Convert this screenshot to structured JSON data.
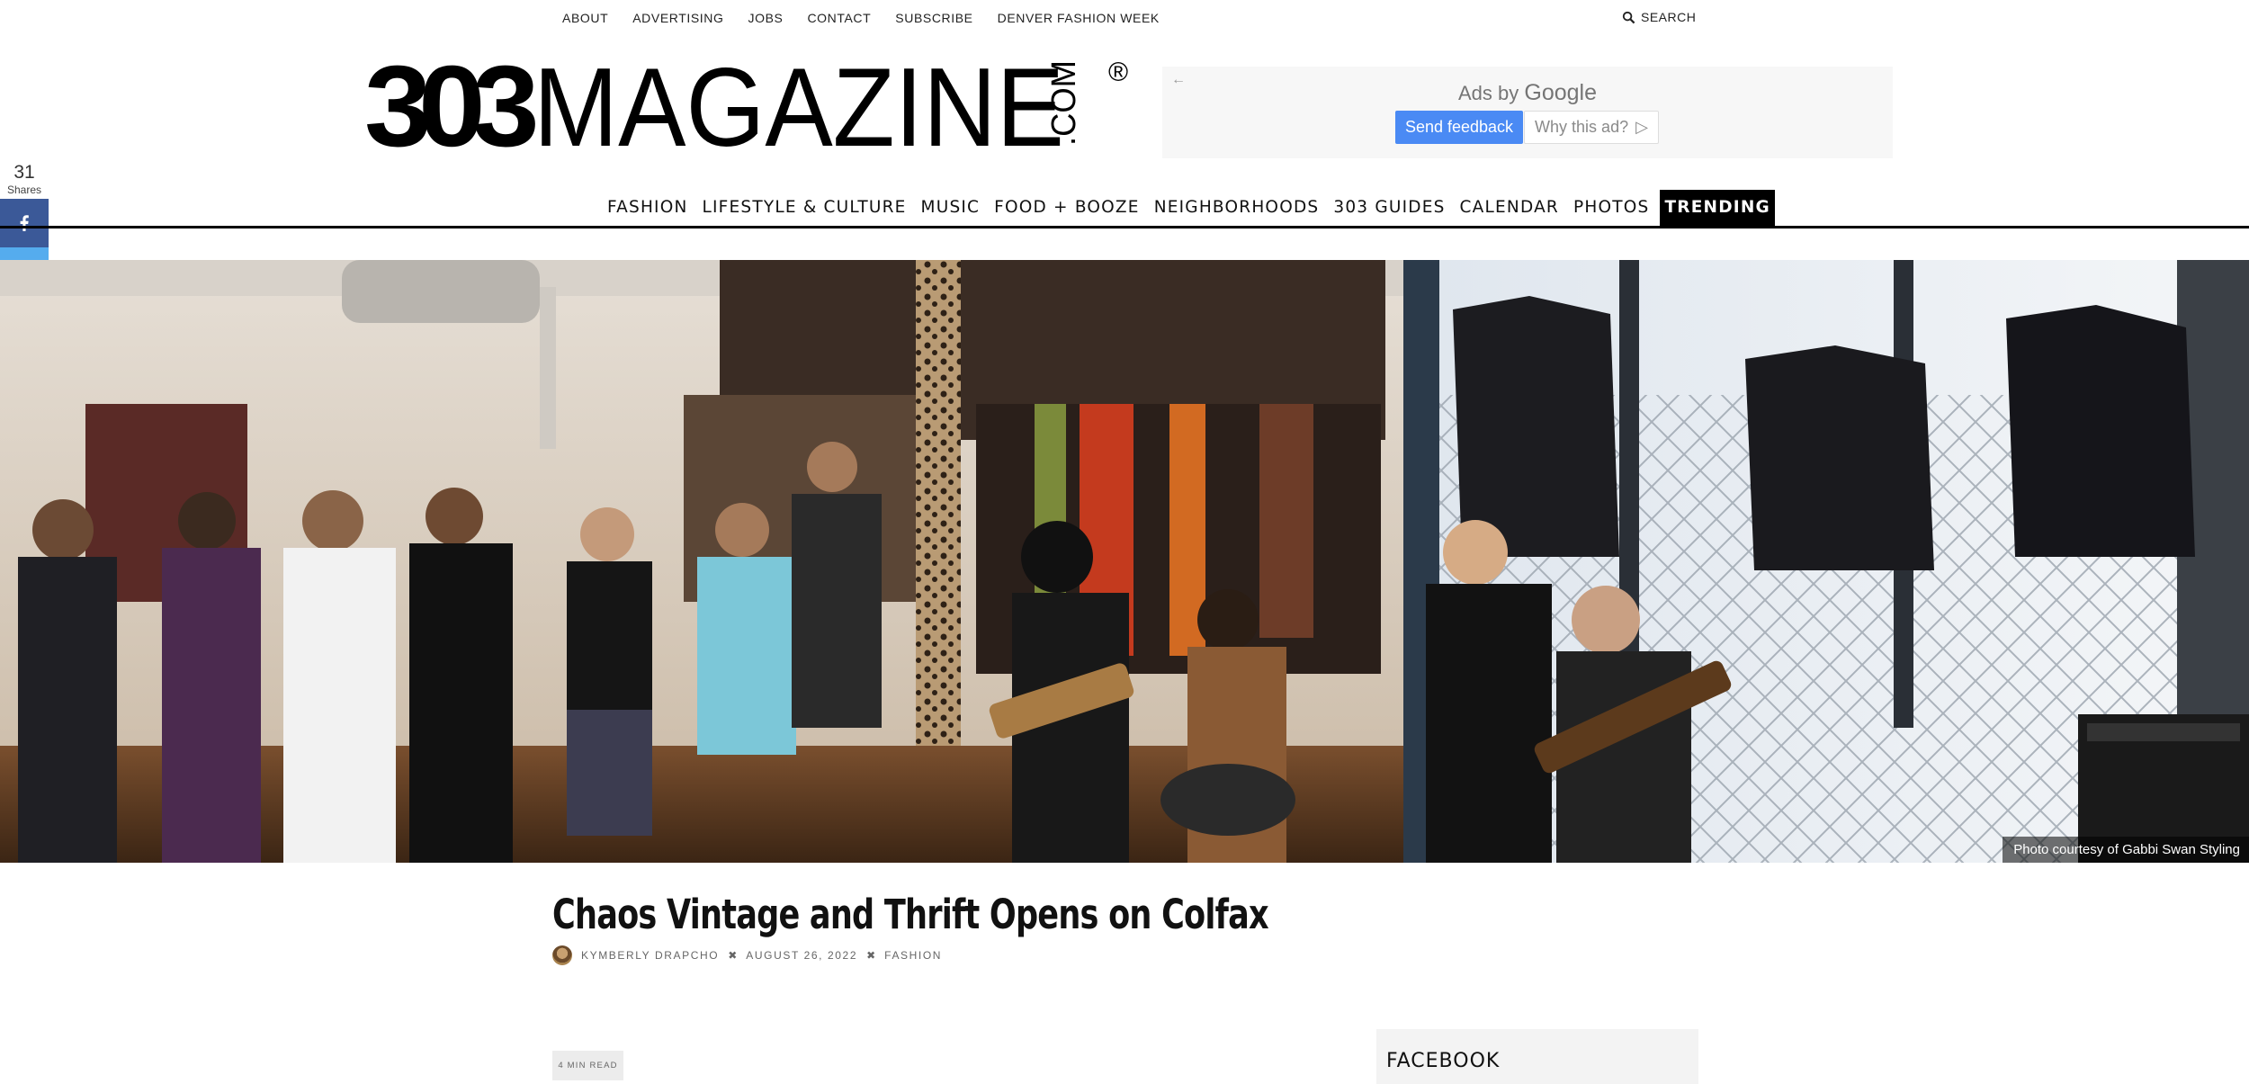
{
  "topnav": {
    "links": [
      "ABOUT",
      "ADVERTISING",
      "JOBS",
      "CONTACT",
      "SUBSCRIBE",
      "DENVER FASHION WEEK"
    ],
    "search_label": "SEARCH"
  },
  "logo": {
    "text_303": "303",
    "text_magazine": "MAGAZINE",
    "text_com": ".COM",
    "registered": "®"
  },
  "ad": {
    "back_arrow": "←",
    "ads_by": "Ads by",
    "google": "Google",
    "send_feedback": "Send feedback",
    "why_this_ad": "Why this ad?",
    "why_icon": "▷"
  },
  "share": {
    "count": "31",
    "label": "Shares",
    "buttons": [
      {
        "icon": "facebook-icon",
        "color": "#3b5998"
      },
      {
        "icon": "twitter-icon",
        "color": "#55acee"
      },
      {
        "icon": "pinterest-icon",
        "color": "#cb2027"
      },
      {
        "icon": "reddit-icon",
        "color": "#ff4500"
      }
    ]
  },
  "mainnav": {
    "items": [
      "FASHION",
      "LIFESTYLE & CULTURE",
      "MUSIC",
      "FOOD + BOOZE",
      "NEIGHBORHOODS",
      "303 GUIDES",
      "CALENDAR",
      "PHOTOS",
      "TRENDING"
    ]
  },
  "hero": {
    "credit": "Photo courtesy of Gabbi Swan Styling"
  },
  "article": {
    "title": "Chaos Vintage and Thrift Opens on Colfax",
    "author": "KYMBERLY DRAPCHO",
    "date": "AUGUST 26, 2022",
    "category": "FASHION",
    "separator": "✖",
    "read_time": "4 MIN READ"
  },
  "sidebar": {
    "widget_title": "FACEBOOK"
  },
  "colors": {
    "accent": "#000000",
    "ad_blue": "#4a8af4"
  }
}
